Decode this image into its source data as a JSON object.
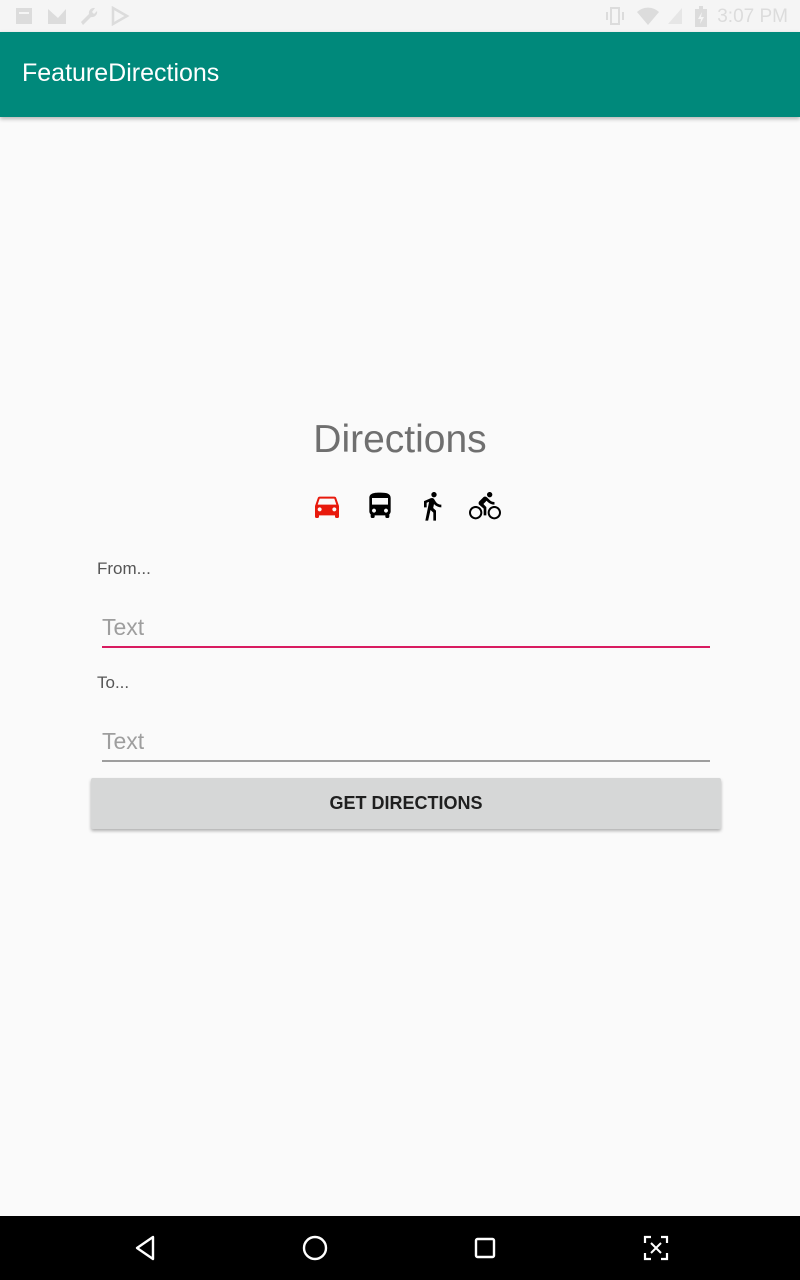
{
  "status_bar": {
    "time": "3:07 PM",
    "icons": [
      "notification-icon",
      "no-signal-icon",
      "wrench-icon",
      "play-store-icon",
      "vibrate-icon",
      "wifi-icon",
      "signal-icon",
      "battery-icon"
    ]
  },
  "app_bar": {
    "title": "FeatureDirections"
  },
  "main": {
    "heading": "Directions",
    "modes": [
      {
        "icon": "car-icon",
        "selected": true,
        "color": "#e8190c"
      },
      {
        "icon": "bus-icon",
        "selected": false,
        "color": "#000000"
      },
      {
        "icon": "walk-icon",
        "selected": false,
        "color": "#000000"
      },
      {
        "icon": "bike-icon",
        "selected": false,
        "color": "#000000"
      }
    ],
    "from_label": "From...",
    "from_placeholder": "Text",
    "to_label": "To...",
    "to_placeholder": "Text",
    "button_label": "GET DIRECTIONS"
  },
  "nav_bar": {
    "buttons": [
      "back-icon",
      "home-icon",
      "recents-icon",
      "screenshot-icon"
    ]
  },
  "colors": {
    "app_bar": "#00897b",
    "accent": "#d81b60",
    "selected_mode": "#e8190c"
  }
}
